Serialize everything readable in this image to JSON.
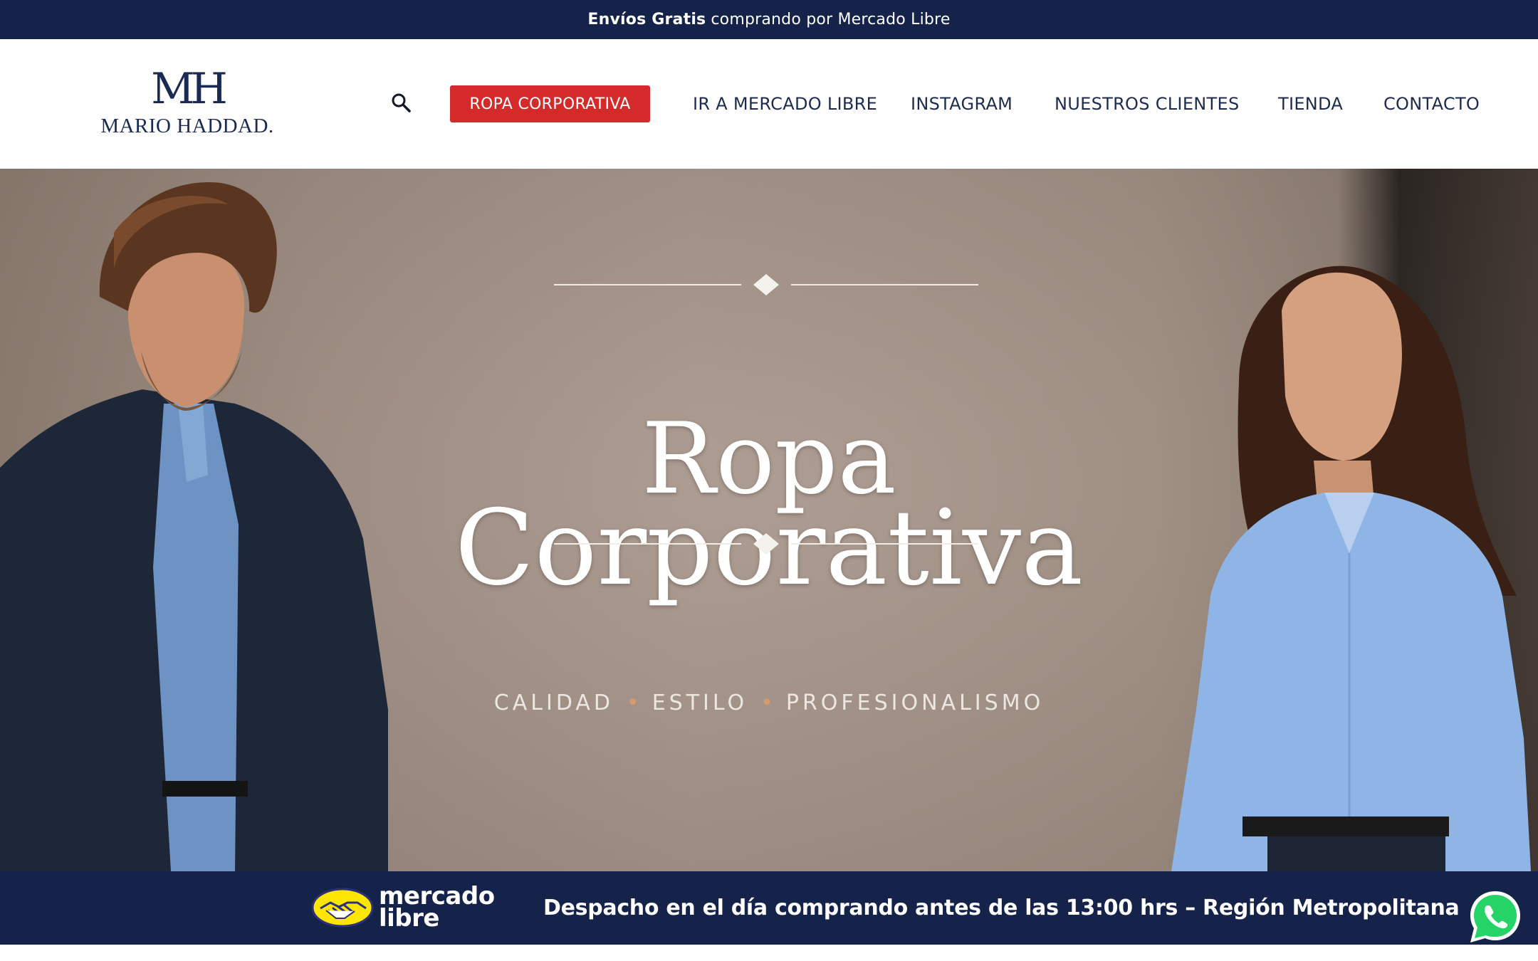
{
  "topbar": {
    "bold": "Envíos Gratis",
    "text": "comprando por Mercado Libre"
  },
  "header": {
    "logo_mark": "MH",
    "logo_text": "MARIO HADDAD.",
    "search_icon": "search-icon",
    "cta_label": "ROPA CORPORATIVA",
    "nav": [
      "IR A MERCADO LIBRE",
      "INSTAGRAM",
      "NUESTROS CLIENTES",
      "TIENDA",
      "CONTACTO"
    ]
  },
  "hero": {
    "title_line1": "Ropa",
    "title_line2": "Corporativa",
    "tag1": "CALIDAD",
    "tag2": "ESTILO",
    "tag3": "PROFESIONALISMO",
    "separator": "•"
  },
  "bottombar": {
    "brand_line1": "mercado",
    "brand_line2": "libre",
    "dispatch": "Despacho en el día comprando antes de las 13:00 hrs – Región Metropolitana"
  },
  "colors": {
    "navy": "#15224a",
    "cta_red": "#d42a2a",
    "nav_text": "#1d2b4e",
    "ml_yellow": "#ffe600",
    "whatsapp_green": "#25d366"
  },
  "icons": [
    "search-icon",
    "mercadolibre-handshake-icon",
    "whatsapp-icon",
    "diamond-ornament-icon"
  ]
}
